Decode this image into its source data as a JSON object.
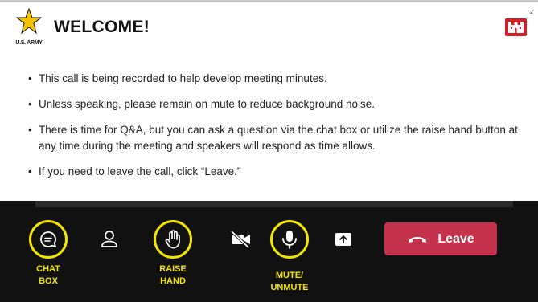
{
  "slide": {
    "logo_text": "U.S. ARMY",
    "title": "WELCOME!",
    "page_number": "2",
    "bullets": [
      "This call is being recorded to help develop meeting minutes.",
      "Unless speaking, please remain on mute to reduce background noise.",
      "There is time for Q&A, but you can ask a question via the chat box or utilize the raise hand button at any time during the meeting and speakers will respond as time allows.",
      "If you need to leave the call, click “Leave.”"
    ]
  },
  "toolbar": {
    "chat_label": "CHAT\nBOX",
    "raise_label": "RAISE\nHAND",
    "mute_label": "MUTE/\nUNMUTE",
    "leave_label": "Leave",
    "highlight_color": "#f2e600",
    "leave_color": "#c4314b"
  }
}
